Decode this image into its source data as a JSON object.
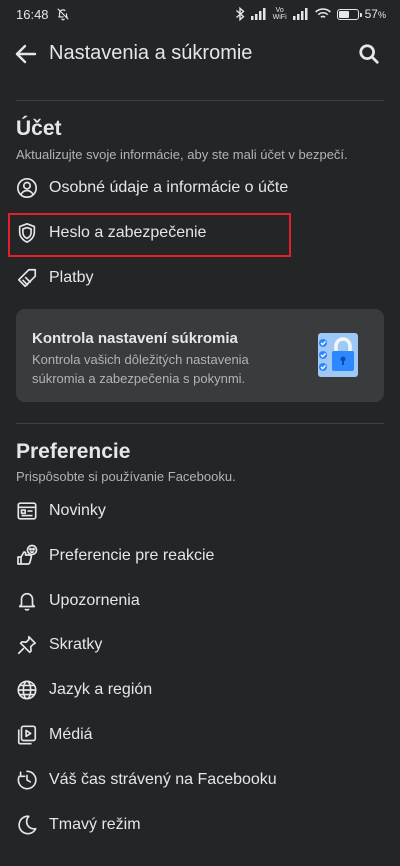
{
  "status_bar": {
    "time": "16:48",
    "volte_top": "Vo",
    "volte_bottom": "WiFi",
    "battery_percent": "57",
    "battery_unit": "%",
    "battery_level": 0.57
  },
  "header": {
    "title": "Nastavenia a súkromie"
  },
  "account": {
    "title": "Účet",
    "subtitle": "Aktualizujte svoje informácie, aby ste mali účet v bezpečí.",
    "items": [
      {
        "label": "Osobné údaje a informácie o účte",
        "icon": "person-icon"
      },
      {
        "label": "Heslo a zabezpečenie",
        "icon": "shield-icon"
      },
      {
        "label": "Platby",
        "icon": "tag-icon"
      }
    ]
  },
  "privacy_card": {
    "title": "Kontrola nastavení súkromia",
    "text": "Kontrola vašich dôležitých nastavenia súkromia a zabezpečenia s pokynmi.",
    "illustration": "lock-checklist-icon"
  },
  "preferences": {
    "title": "Preferencie",
    "subtitle": "Prispôsobte si používanie Facebooku.",
    "items": [
      {
        "label": "Novinky",
        "icon": "news-feed-icon"
      },
      {
        "label": "Preferencie pre reakcie",
        "icon": "reactions-icon"
      },
      {
        "label": "Upozornenia",
        "icon": "bell-icon"
      },
      {
        "label": "Skratky",
        "icon": "pin-icon"
      },
      {
        "label": "Jazyk a región",
        "icon": "globe-icon"
      },
      {
        "label": "Médiá",
        "icon": "media-icon"
      },
      {
        "label": "Váš čas strávený na Facebooku",
        "icon": "clock-icon"
      },
      {
        "label": "Tmavý režim",
        "icon": "moon-icon"
      }
    ]
  },
  "colors": {
    "background": "#242526",
    "card": "#3a3b3c",
    "highlight_border": "#e0202a",
    "accent_blue": "#2d88ff"
  }
}
